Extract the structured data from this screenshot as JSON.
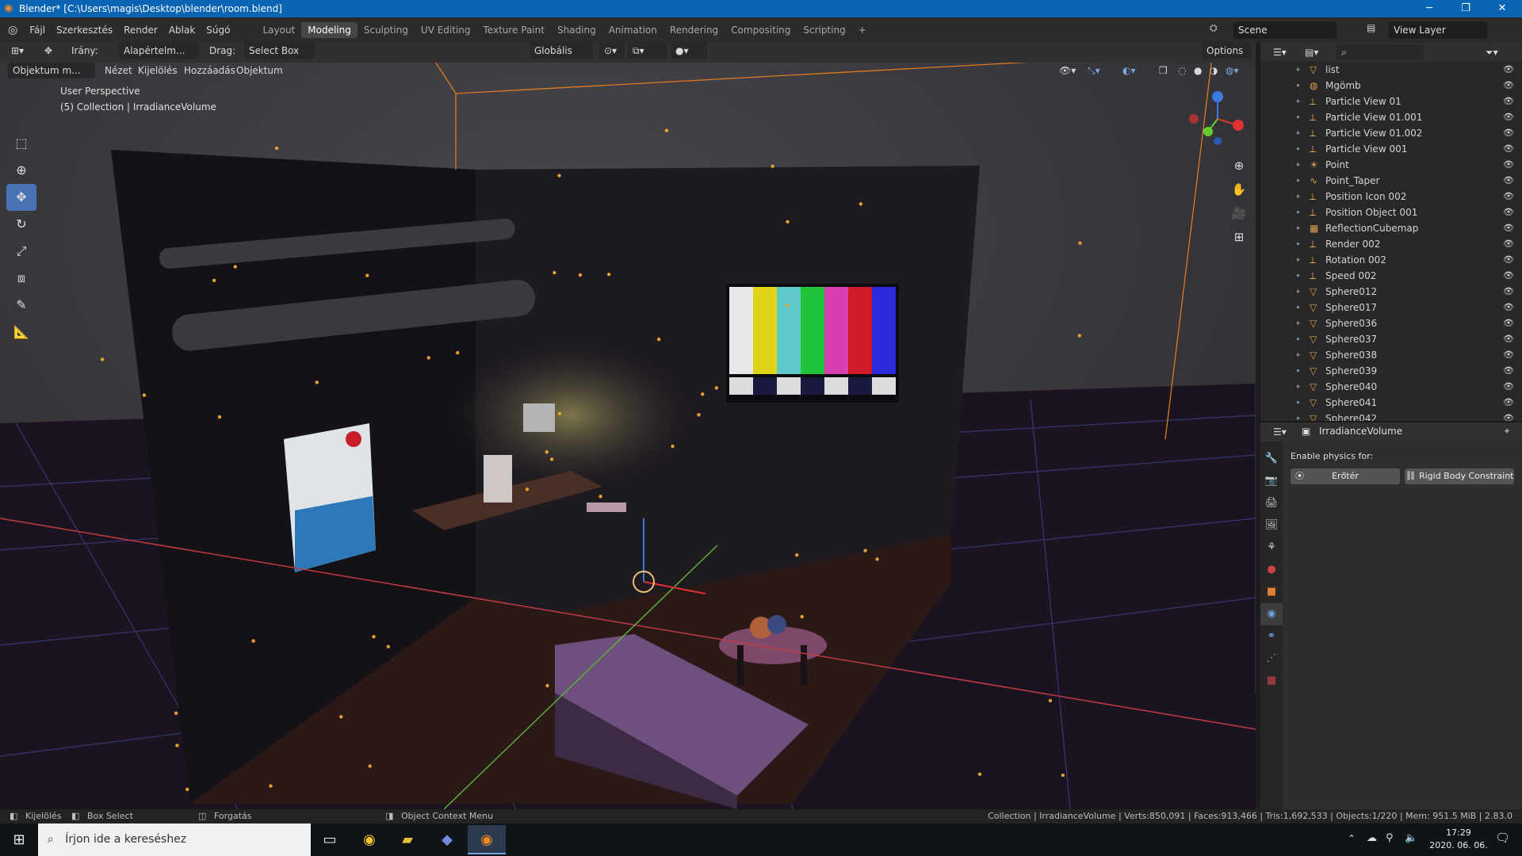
{
  "window": {
    "title": "Blender* [C:\\Users\\magis\\Desktop\\blender\\room.blend]"
  },
  "menu": [
    "Fájl",
    "Szerkesztés",
    "Render",
    "Ablak",
    "Súgó"
  ],
  "workspaces": [
    "Layout",
    "Modeling",
    "Sculpting",
    "UV Editing",
    "Texture Paint",
    "Shading",
    "Animation",
    "Rendering",
    "Compositing",
    "Scripting"
  ],
  "active_workspace": "Modeling",
  "scene": "Scene",
  "view_layer": "View Layer",
  "header": {
    "irany_label": "Irány:",
    "orientation": "Alapértelm...",
    "drag_label": "Drag:",
    "drag_value": "Select Box",
    "transform": "Globális",
    "options": "Options",
    "mode": "Objektum m...",
    "view": "Nézet",
    "select": "Kijelölés",
    "add": "Hozzáadás",
    "object": "Objektum"
  },
  "viewport": {
    "perspective": "User Perspective",
    "collection": "(5) Collection | IrradianceVolume"
  },
  "outliner": {
    "items": [
      {
        "name": "list",
        "icon": "mesh-icon"
      },
      {
        "name": "Mgömb",
        "icon": "metaball-icon"
      },
      {
        "name": "Particle View 01",
        "icon": "empty-icon"
      },
      {
        "name": "Particle View 01.001",
        "icon": "empty-icon"
      },
      {
        "name": "Particle View 01.002",
        "icon": "empty-icon"
      },
      {
        "name": "Particle View 001",
        "icon": "empty-icon"
      },
      {
        "name": "Point",
        "icon": "light-icon"
      },
      {
        "name": "Point_Taper",
        "icon": "curve-icon"
      },
      {
        "name": "Position Icon 002",
        "icon": "empty-icon"
      },
      {
        "name": "Position Object 001",
        "icon": "empty-icon"
      },
      {
        "name": "ReflectionCubemap",
        "icon": "probe-icon"
      },
      {
        "name": "Render 002",
        "icon": "empty-icon"
      },
      {
        "name": "Rotation 002",
        "icon": "empty-icon"
      },
      {
        "name": "Speed 002",
        "icon": "empty-icon"
      },
      {
        "name": "Sphere012",
        "icon": "mesh-icon"
      },
      {
        "name": "Sphere017",
        "icon": "mesh-icon"
      },
      {
        "name": "Sphere036",
        "icon": "mesh-icon"
      },
      {
        "name": "Sphere037",
        "icon": "mesh-icon"
      },
      {
        "name": "Sphere038",
        "icon": "mesh-icon"
      },
      {
        "name": "Sphere039",
        "icon": "mesh-icon"
      },
      {
        "name": "Sphere040",
        "icon": "mesh-icon"
      },
      {
        "name": "Sphere041",
        "icon": "mesh-icon"
      },
      {
        "name": "Sphere042",
        "icon": "mesh-icon"
      }
    ]
  },
  "properties": {
    "object_name": "IrradianceVolume",
    "enable_physics": "Enable physics for:",
    "force_field": "Erőtér",
    "rigid_body_constraint": "Rigid Body Constraint"
  },
  "status": {
    "select": "Kijelölés",
    "box_select": "Box Select",
    "rotate": "Forgatás",
    "context_menu": "Object Context Menu",
    "stats": "Collection | IrradianceVolume | Verts:850,091 | Faces:913,466 | Tris:1,692,533 | Objects:1/220 | Mem: 951.5 MiB | 2.83.0"
  },
  "taskbar": {
    "search_placeholder": "Írjon ide a kereséshez",
    "time": "17:29",
    "date": "2020. 06. 06."
  },
  "tv_colors": [
    "#e8e8e8",
    "#e0d31a",
    "#5fc9c9",
    "#20c43a",
    "#d83fb0",
    "#d01a2a",
    "#2a2ad8"
  ],
  "accent": "#4772b3"
}
